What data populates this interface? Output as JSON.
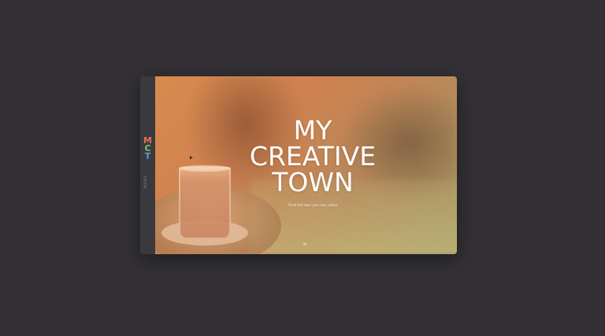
{
  "sidebar": {
    "logo": {
      "letters": [
        "M",
        "C",
        "T"
      ],
      "colors": [
        "#e0734f",
        "#8fbf6a",
        "#4f9fd6"
      ]
    },
    "menu_label": "MENU"
  },
  "hero": {
    "title_lines": [
      "MY",
      "CREATIVE",
      "TOWN"
    ],
    "tagline": "Think the town your own colour",
    "scroll_icon": "chevron-down-icon"
  }
}
